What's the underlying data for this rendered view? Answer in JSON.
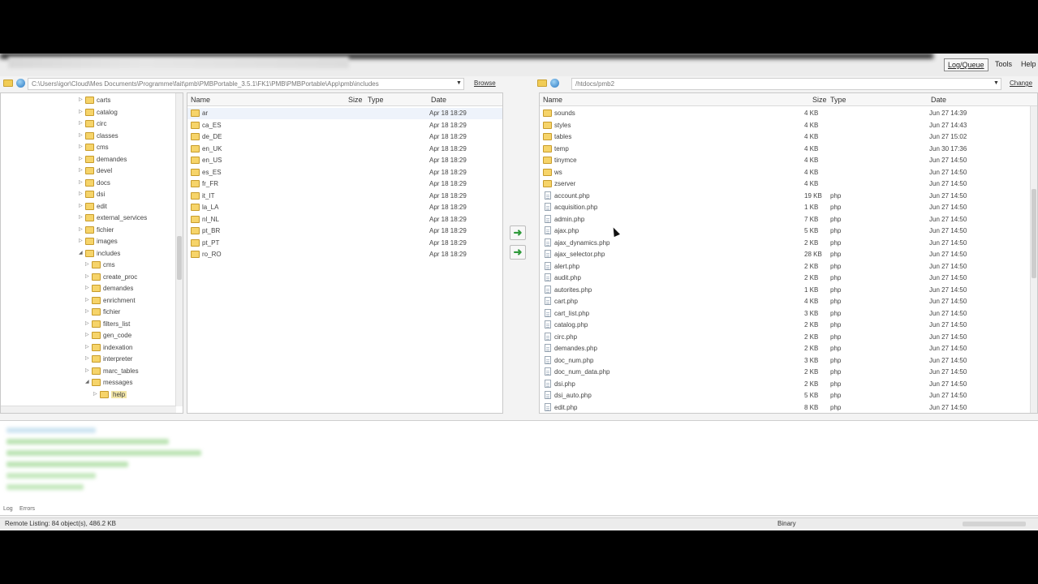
{
  "toolbar": {
    "log_queue": "Log/Queue",
    "tools": "Tools",
    "help": "Help"
  },
  "local": {
    "path": "C:\\Users\\igor\\Cloud\\Mes Documents\\Programme\\fait\\pmb\\PMBPortable_3.5.1\\FK1\\PMB\\PMBPortable\\App\\pmb\\includes",
    "browse_label": "Browse",
    "tree": [
      {
        "label": "carts",
        "depth": 1
      },
      {
        "label": "catalog",
        "depth": 1
      },
      {
        "label": "circ",
        "depth": 1
      },
      {
        "label": "classes",
        "depth": 1
      },
      {
        "label": "cms",
        "depth": 1
      },
      {
        "label": "demandes",
        "depth": 1
      },
      {
        "label": "devel",
        "depth": 1
      },
      {
        "label": "docs",
        "depth": 1
      },
      {
        "label": "dsi",
        "depth": 1
      },
      {
        "label": "edit",
        "depth": 1
      },
      {
        "label": "external_services",
        "depth": 1
      },
      {
        "label": "fichier",
        "depth": 1
      },
      {
        "label": "images",
        "depth": 1
      },
      {
        "label": "includes",
        "depth": 1
      },
      {
        "label": "cms",
        "depth": 2
      },
      {
        "label": "create_proc",
        "depth": 2
      },
      {
        "label": "demandes",
        "depth": 2
      },
      {
        "label": "enrichment",
        "depth": 2
      },
      {
        "label": "fichier",
        "depth": 2
      },
      {
        "label": "filters_list",
        "depth": 2
      },
      {
        "label": "gen_code",
        "depth": 2
      },
      {
        "label": "indexation",
        "depth": 2
      },
      {
        "label": "interpreter",
        "depth": 2
      },
      {
        "label": "marc_tables",
        "depth": 2
      },
      {
        "label": "messages",
        "depth": 2
      },
      {
        "label": "help",
        "depth": 3
      }
    ],
    "columns": {
      "name": "Name",
      "size": "Size",
      "type": "Type",
      "date": "Date"
    },
    "files": [
      {
        "name": "ar",
        "date": "Apr 18 18:29"
      },
      {
        "name": "ca_ES",
        "date": "Apr 18 18:29"
      },
      {
        "name": "de_DE",
        "date": "Apr 18 18:29"
      },
      {
        "name": "en_UK",
        "date": "Apr 18 18:29"
      },
      {
        "name": "en_US",
        "date": "Apr 18 18:29"
      },
      {
        "name": "es_ES",
        "date": "Apr 18 18:29"
      },
      {
        "name": "fr_FR",
        "date": "Apr 18 18:29"
      },
      {
        "name": "it_IT",
        "date": "Apr 18 18:29"
      },
      {
        "name": "la_LA",
        "date": "Apr 18 18:29"
      },
      {
        "name": "nl_NL",
        "date": "Apr 18 18:29"
      },
      {
        "name": "pt_BR",
        "date": "Apr 18 18:29"
      },
      {
        "name": "pt_PT",
        "date": "Apr 18 18:29"
      },
      {
        "name": "ro_RO",
        "date": "Apr 18 18:29"
      }
    ]
  },
  "remote": {
    "path": "/htdocs/pmb2",
    "change_label": "Change",
    "columns": {
      "name": "Name",
      "size": "Size",
      "type": "Type",
      "date": "Date"
    },
    "files": [
      {
        "name": "sounds",
        "size": "4 KB",
        "type": "",
        "date": "Jun 27 14:39",
        "kind": "folder"
      },
      {
        "name": "styles",
        "size": "4 KB",
        "type": "",
        "date": "Jun 27 14:43",
        "kind": "folder"
      },
      {
        "name": "tables",
        "size": "4 KB",
        "type": "",
        "date": "Jun 27 15:02",
        "kind": "folder"
      },
      {
        "name": "temp",
        "size": "4 KB",
        "type": "",
        "date": "Jun 30 17:36",
        "kind": "folder"
      },
      {
        "name": "tinymce",
        "size": "4 KB",
        "type": "",
        "date": "Jun 27 14:50",
        "kind": "folder"
      },
      {
        "name": "ws",
        "size": "4 KB",
        "type": "",
        "date": "Jun 27 14:50",
        "kind": "folder"
      },
      {
        "name": "zserver",
        "size": "4 KB",
        "type": "",
        "date": "Jun 27 14:50",
        "kind": "folder"
      },
      {
        "name": "account.php",
        "size": "19 KB",
        "type": "php",
        "date": "Jun 27 14:50",
        "kind": "file"
      },
      {
        "name": "acquisition.php",
        "size": "1 KB",
        "type": "php",
        "date": "Jun 27 14:50",
        "kind": "file"
      },
      {
        "name": "admin.php",
        "size": "7 KB",
        "type": "php",
        "date": "Jun 27 14:50",
        "kind": "file"
      },
      {
        "name": "ajax.php",
        "size": "5 KB",
        "type": "php",
        "date": "Jun 27 14:50",
        "kind": "file"
      },
      {
        "name": "ajax_dynamics.php",
        "size": "2 KB",
        "type": "php",
        "date": "Jun 27 14:50",
        "kind": "file"
      },
      {
        "name": "ajax_selector.php",
        "size": "28 KB",
        "type": "php",
        "date": "Jun 27 14:50",
        "kind": "file"
      },
      {
        "name": "alert.php",
        "size": "2 KB",
        "type": "php",
        "date": "Jun 27 14:50",
        "kind": "file"
      },
      {
        "name": "audit.php",
        "size": "2 KB",
        "type": "php",
        "date": "Jun 27 14:50",
        "kind": "file"
      },
      {
        "name": "autorites.php",
        "size": "1 KB",
        "type": "php",
        "date": "Jun 27 14:50",
        "kind": "file"
      },
      {
        "name": "cart.php",
        "size": "4 KB",
        "type": "php",
        "date": "Jun 27 14:50",
        "kind": "file"
      },
      {
        "name": "cart_list.php",
        "size": "3 KB",
        "type": "php",
        "date": "Jun 27 14:50",
        "kind": "file"
      },
      {
        "name": "catalog.php",
        "size": "2 KB",
        "type": "php",
        "date": "Jun 27 14:50",
        "kind": "file"
      },
      {
        "name": "circ.php",
        "size": "2 KB",
        "type": "php",
        "date": "Jun 27 14:50",
        "kind": "file"
      },
      {
        "name": "demandes.php",
        "size": "2 KB",
        "type": "php",
        "date": "Jun 27 14:50",
        "kind": "file"
      },
      {
        "name": "doc_num.php",
        "size": "3 KB",
        "type": "php",
        "date": "Jun 27 14:50",
        "kind": "file"
      },
      {
        "name": "doc_num_data.php",
        "size": "2 KB",
        "type": "php",
        "date": "Jun 27 14:50",
        "kind": "file"
      },
      {
        "name": "dsi.php",
        "size": "2 KB",
        "type": "php",
        "date": "Jun 27 14:50",
        "kind": "file"
      },
      {
        "name": "dsi_auto.php",
        "size": "5 KB",
        "type": "php",
        "date": "Jun 27 14:50",
        "kind": "file"
      },
      {
        "name": "edit.php",
        "size": "8 KB",
        "type": "php",
        "date": "Jun 27 14:50",
        "kind": "file"
      }
    ]
  },
  "log": {
    "tab_log": "Log",
    "tab_errors": "Errors"
  },
  "status": {
    "listing": "Remote Listing: 84 object(s), 486.2 KB",
    "mode": "Binary"
  },
  "colors": {
    "folder": "#f6d46a",
    "transfer_arrow": "#2f9a3b",
    "log_text": "#7ac56f"
  }
}
